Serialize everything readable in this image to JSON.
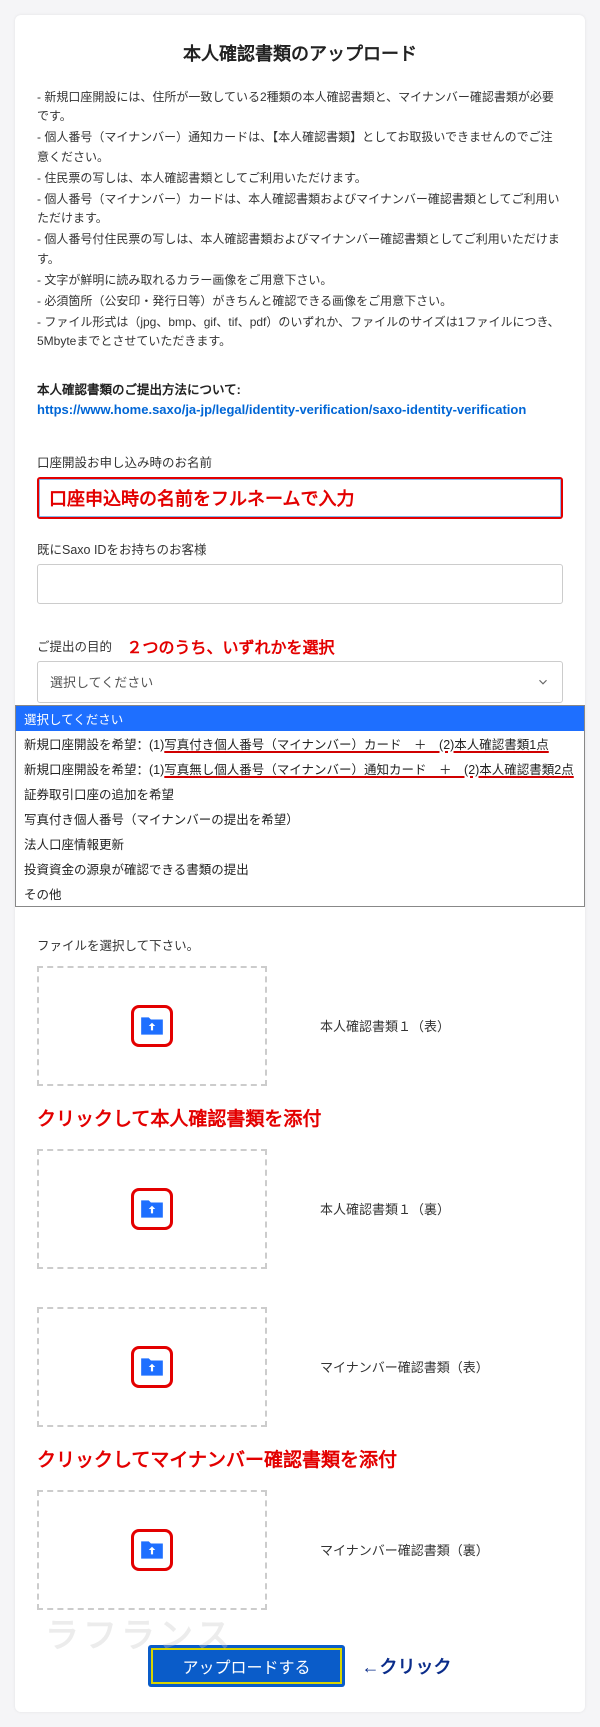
{
  "title": "本人確認書類のアップロード",
  "bullets": [
    "- 新規口座開設には、住所が一致している2種類の本人確認書類と、マイナンバー確認書類が必要です。",
    "- 個人番号（マイナンバー）通知カードは、【本人確認書類】としてお取扱いできませんのでご注意ください。",
    "- 住民票の写しは、本人確認書類としてご利用いただけます。",
    "- 個人番号（マイナンバー）カードは、本人確認書類およびマイナンバー確認書類としてご利用いただけます。",
    "- 個人番号付住民票の写しは、本人確認書類およびマイナンバー確認書類としてご利用いただけます。",
    "- 文字が鮮明に読み取れるカラー画像をご用意下さい。",
    "- 必須箇所（公安印・発行日等）がきちんと確認できる画像をご用意下さい。",
    "- ファイル形式は（jpg、bmp、gif、tif、pdf）のいずれか、ファイルのサイズは1ファイルにつき、5Mbyteまでとさせていただきます。"
  ],
  "guide": {
    "label": "本人確認書類のご提出方法について:",
    "url": "https://www.home.saxo/ja-jp/legal/identity-verification/saxo-identity-verification"
  },
  "fields": {
    "name_label": "口座開設お申し込み時のお名前",
    "name_annotation": "口座申込時の名前をフルネームで入力",
    "saxo_id_label": "既にSaxo IDをお持ちのお客様",
    "purpose_label": "ご提出の目的",
    "purpose_annotation": "２つのうち、いずれかを選択",
    "purpose_placeholder": "選択してください"
  },
  "options": [
    {
      "text": "選択してください",
      "selected": true
    },
    {
      "prefix": "新規口座開設を希望：(1)",
      "underline": "写真付き個人番号（マイナンバー）カード　＋　(2)本人確認書類1点"
    },
    {
      "prefix": "新規口座開設を希望：(1)",
      "underline": "写真無し個人番号（マイナンバー）通知カード　＋　(2)本人確認書類2点"
    },
    {
      "text": "証券取引口座の追加を希望"
    },
    {
      "text": "写真付き個人番号（マイナンバーの提出を希望）"
    },
    {
      "text": "法人口座情報更新"
    },
    {
      "text": "投資資金の源泉が確認できる書類の提出"
    },
    {
      "text": "その他"
    }
  ],
  "file_pick_label": "ファイルを選択して下さい。",
  "uploads": {
    "doc1_front": "本人確認書類１（表）",
    "doc1_back": "本人確認書類１（裏）",
    "myno_front": "マイナンバー確認書類（表）",
    "myno_back": "マイナンバー確認書類（裏）",
    "annot_identity": "クリックして本人確認書類を添付",
    "annot_mynumber": "クリックしてマイナンバー確認書類を添付"
  },
  "submit": {
    "label": "アップロードする",
    "arrow": "←クリック"
  },
  "watermark": "ラフランス"
}
